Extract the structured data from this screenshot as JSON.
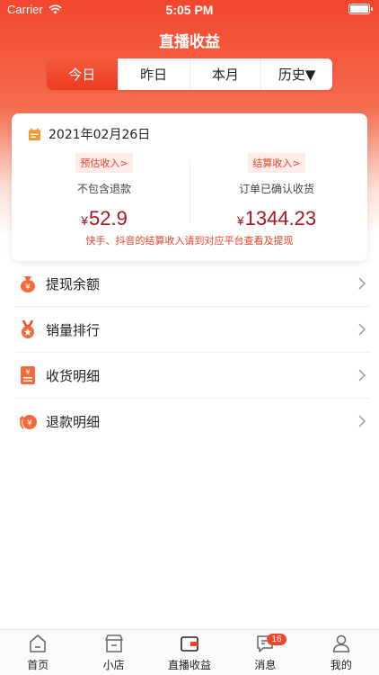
{
  "status": {
    "carrier": "Carrier",
    "time": "5:05 PM"
  },
  "title": "直播收益",
  "tabs": [
    {
      "label": "今日",
      "active": true
    },
    {
      "label": "昨日",
      "active": false
    },
    {
      "label": "本月",
      "active": false
    },
    {
      "label": "历史▼",
      "active": false
    }
  ],
  "card": {
    "date": "2021年02月26日",
    "estimated": {
      "badge": "预估收入>",
      "sub": "不包含退款",
      "currency": "¥",
      "amount": "52.9"
    },
    "settled": {
      "badge": "结算收入>",
      "sub": "订单已确认收货",
      "currency": "¥",
      "amount": "1344.23"
    },
    "note": "快手、抖音的结算收入请到对应平台查看及提现"
  },
  "menu": [
    {
      "label": "提现余额",
      "icon": "money-bag-icon"
    },
    {
      "label": "销量排行",
      "icon": "medal-icon"
    },
    {
      "label": "收货明细",
      "icon": "receipt-icon"
    },
    {
      "label": "退款明细",
      "icon": "refund-icon"
    }
  ],
  "tabbar": [
    {
      "label": "首页",
      "icon": "home-icon"
    },
    {
      "label": "小店",
      "icon": "shop-icon"
    },
    {
      "label": "直播收益",
      "icon": "wallet-icon"
    },
    {
      "label": "消息",
      "icon": "message-icon",
      "badge": "16"
    },
    {
      "label": "我的",
      "icon": "user-icon"
    }
  ],
  "colors": {
    "accent": "#f2472e",
    "amount": "#a3171c"
  }
}
